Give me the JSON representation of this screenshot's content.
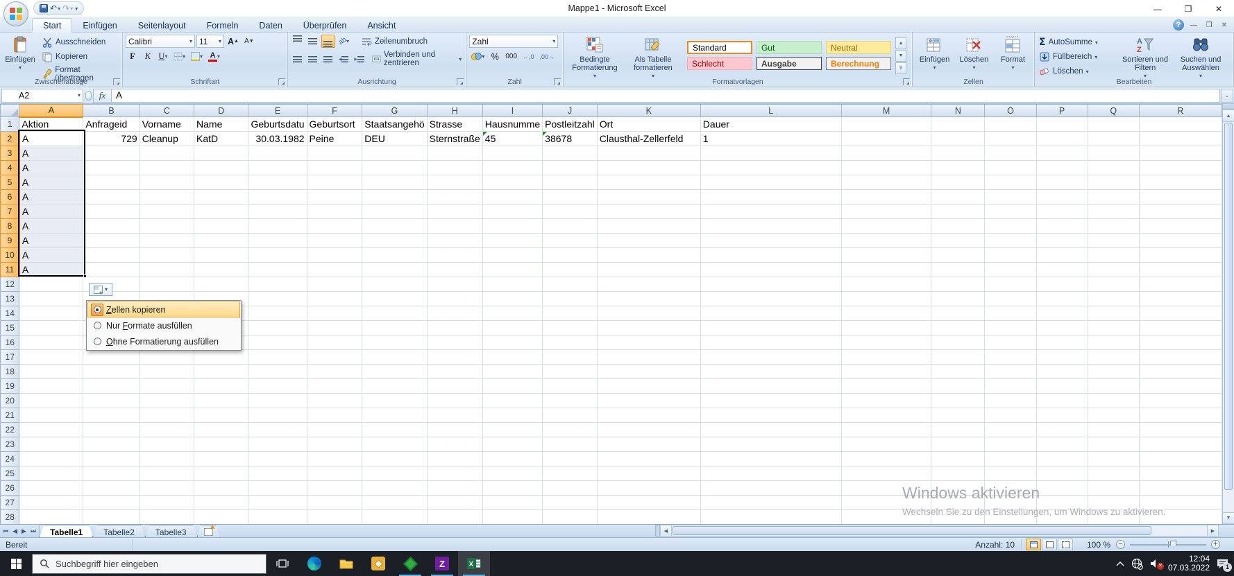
{
  "window": {
    "title": "Mappe1 - Microsoft Excel"
  },
  "ribbon": {
    "tabs": [
      {
        "label": "Start"
      },
      {
        "label": "Einfügen"
      },
      {
        "label": "Seitenlayout"
      },
      {
        "label": "Formeln"
      },
      {
        "label": "Daten"
      },
      {
        "label": "Überprüfen"
      },
      {
        "label": "Ansicht"
      }
    ],
    "clipboard": {
      "label": "Zwischenablage",
      "paste": "Einfügen",
      "cut": "Ausschneiden",
      "copy": "Kopieren",
      "painter": "Format übertragen"
    },
    "font": {
      "label": "Schriftart",
      "family": "Calibri",
      "size": "11",
      "bold": "F",
      "italic": "K",
      "underline": "U",
      "grow": "A",
      "shrink": "A",
      "color_letter": "A"
    },
    "alignment": {
      "label": "Ausrichtung",
      "wrap": "Zeilenumbruch",
      "merge": "Verbinden und zentrieren",
      "orient": "ab"
    },
    "number": {
      "label": "Zahl",
      "format": "Zahl",
      "percent": "%",
      "thousands": "000",
      "dec_add": "←,0",
      "dec_del": ",00→"
    },
    "styles": {
      "label": "Formatvorlagen",
      "conditional": "Bedingte Formatierung",
      "as_table": "Als Tabelle formatieren",
      "chips": [
        "Standard",
        "Gut",
        "Neutral",
        "Schlecht",
        "Ausgabe",
        "Berechnung"
      ]
    },
    "cells": {
      "label": "Zellen",
      "insert": "Einfügen",
      "delete": "Löschen",
      "format": "Format"
    },
    "editing": {
      "label": "Bearbeiten",
      "sigma": "Σ",
      "autosum": "AutoSumme",
      "fill": "Füllbereich",
      "clear": "Löschen",
      "sort": "Sortieren und Filtern",
      "find": "Suchen und Auswählen"
    }
  },
  "formula_bar": {
    "name_box": "A2",
    "fx": "fx",
    "value": "A"
  },
  "grid": {
    "columns": [
      "A",
      "B",
      "C",
      "D",
      "E",
      "F",
      "G",
      "H",
      "I",
      "J",
      "K",
      "L",
      "M",
      "N",
      "O",
      "P",
      "Q",
      "R"
    ],
    "row_count": 28,
    "cells": {
      "A1": "Aktion",
      "B1": "Anfrageid",
      "C1": "Vorname",
      "D1": "Name",
      "E1": "Geburtsdatu",
      "F1": "Geburtsort",
      "G1": "Staatsangehö",
      "H1": "Strasse",
      "I1": "Hausnumme",
      "J1": "Postleitzahl",
      "K1": "Ort",
      "L1": "Dauer",
      "A2": "A",
      "B2": "729",
      "C2": "Cleanup",
      "D2": "KatD",
      "E2": "30.03.1982",
      "F2": "Peine",
      "G2": "DEU",
      "H2": "Sternstraße",
      "I2": "45",
      "J2": "38678",
      "K2": "Clausthal-Zellerfeld",
      "L2": "1",
      "A3": "A",
      "A4": "A",
      "A5": "A",
      "A6": "A",
      "A7": "A",
      "A8": "A",
      "A9": "A",
      "A10": "A",
      "A11": "A"
    },
    "right_aligned": [
      "B2",
      "E2"
    ],
    "error_flags": [
      "I2",
      "J2"
    ],
    "selection": {
      "range": "A2:A11",
      "active_cell": "A2",
      "first_row": 2,
      "last_row": 11,
      "column": "A"
    }
  },
  "fill_menu": {
    "items": [
      {
        "label": "Zellen kopieren",
        "accel": "Z",
        "selected": true
      },
      {
        "label": "Nur Formate ausfüllen",
        "accel": "F",
        "selected": false
      },
      {
        "label": "Ohne Formatierung ausfüllen",
        "accel": "O",
        "selected": false
      }
    ]
  },
  "sheet_tabs": {
    "tabs": [
      {
        "label": "Tabelle1"
      },
      {
        "label": "Tabelle2"
      },
      {
        "label": "Tabelle3"
      }
    ]
  },
  "status_bar": {
    "mode": "Bereit",
    "count": "Anzahl: 10",
    "zoom": "100 %"
  },
  "watermark": {
    "line1": "Windows aktivieren",
    "line2": "Wechseln Sie zu den Einstellungen, um Windows zu aktivieren."
  },
  "taskbar": {
    "search_placeholder": "Suchbegriff hier eingeben",
    "time": "12:04",
    "date": "07.03.2022",
    "notification_badge": "1"
  }
}
